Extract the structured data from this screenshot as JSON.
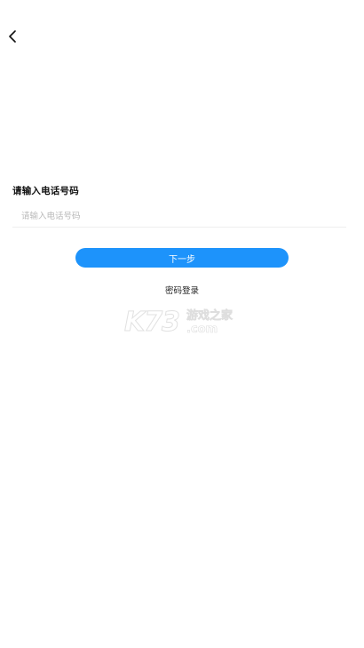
{
  "header": {
    "back_icon": "chevron-left-icon"
  },
  "form": {
    "phone_label": "请输入电话号码",
    "phone_placeholder": "请输入电话号码",
    "phone_value": "",
    "next_label": "下一步",
    "password_login_label": "密码登录"
  },
  "watermark": {
    "logo_text": "K73",
    "site_name": "游戏之家",
    "domain_suffix": ".com"
  },
  "colors": {
    "accent": "#1d93fb",
    "background": "#ffffff",
    "text": "#111111",
    "placeholder": "#b8b8b8"
  }
}
